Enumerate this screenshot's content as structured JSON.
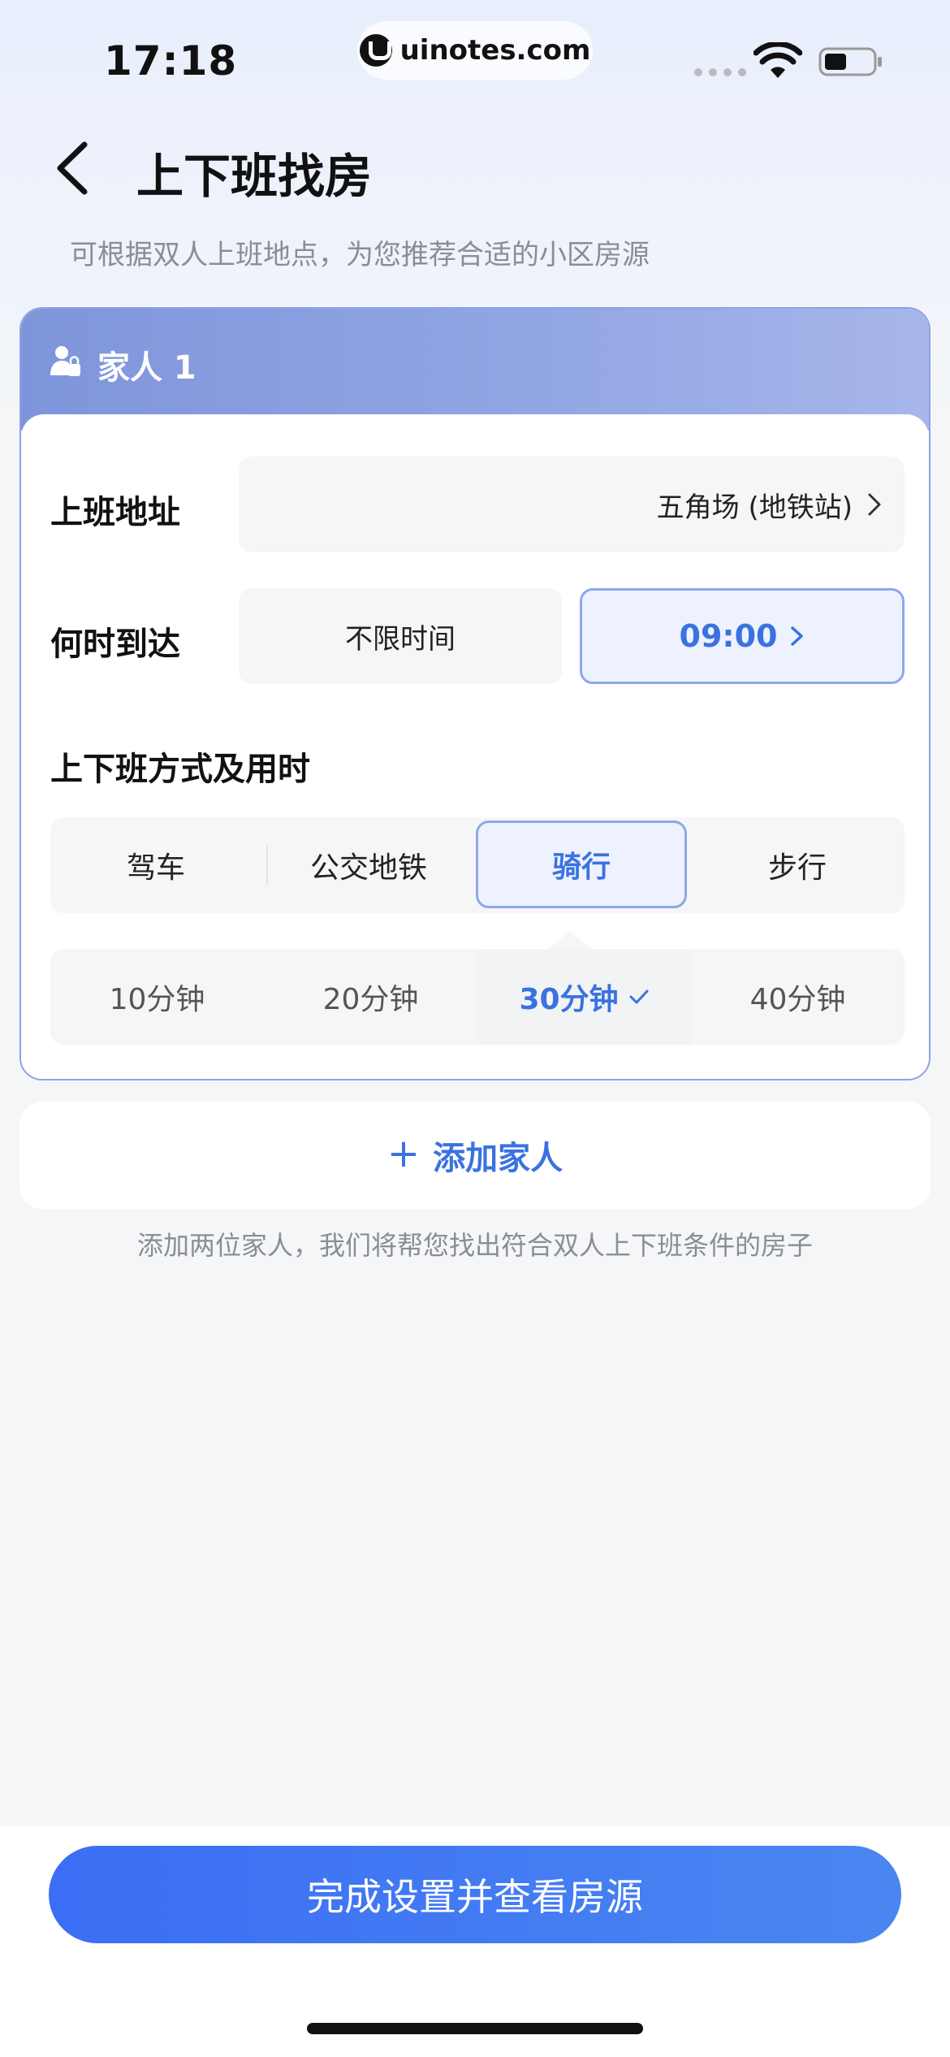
{
  "status_bar": {
    "time": "17:18",
    "url": "uinotes.com",
    "icons": [
      "signal-icon",
      "wifi-icon",
      "battery-icon"
    ]
  },
  "header": {
    "title": "上下班找房",
    "subtitle": "可根据双人上班地点，为您推荐合适的小区房源"
  },
  "family": {
    "title": "家人 1",
    "address": {
      "label": "上班地址",
      "value": "五角场 (地铁站)"
    },
    "arrival": {
      "label": "何时到达",
      "unlimited": "不限时间",
      "selected": "09:00"
    },
    "commute": {
      "title": "上下班方式及用时",
      "modes": [
        {
          "label": "驾车",
          "active": false
        },
        {
          "label": "公交地铁",
          "active": false
        },
        {
          "label": "骑行",
          "active": true
        },
        {
          "label": "步行",
          "active": false
        }
      ],
      "durations": [
        {
          "label": "10分钟",
          "active": false
        },
        {
          "label": "20分钟",
          "active": false
        },
        {
          "label": "30分钟",
          "active": true
        },
        {
          "label": "40分钟",
          "active": false
        }
      ]
    }
  },
  "add_family": {
    "label": "添加家人",
    "hint": "添加两位家人，我们将帮您找出符合双人上下班条件的房子"
  },
  "submit": {
    "label": "完成设置并查看房源"
  },
  "colors": {
    "accent": "#3a72e0",
    "accent_border": "#8fa6ea",
    "card_header": "#8a9fe0",
    "button": "#3b6ef4"
  }
}
